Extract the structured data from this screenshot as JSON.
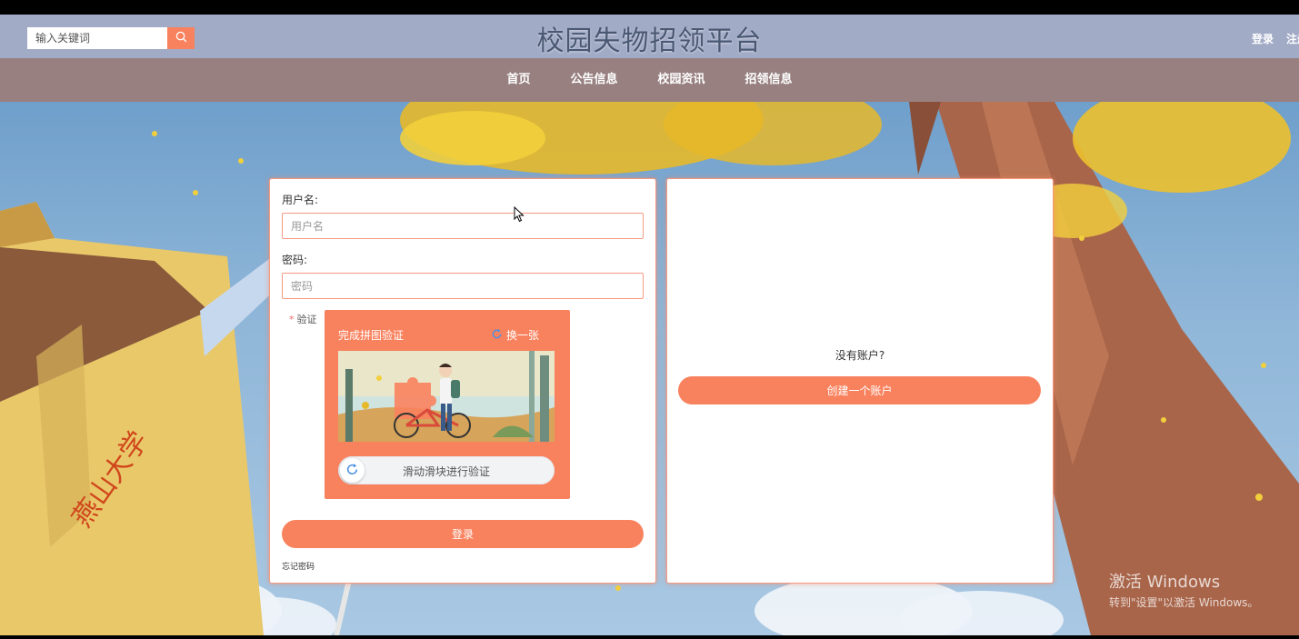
{
  "header": {
    "search_placeholder": "输入关键词",
    "site_title": "校园失物招领平台",
    "login_link": "登录",
    "register_link": "注册"
  },
  "nav": {
    "items": [
      {
        "label": "首页"
      },
      {
        "label": "公告信息"
      },
      {
        "label": "校园资讯"
      },
      {
        "label": "招领信息"
      }
    ]
  },
  "login_form": {
    "username_label": "用户名:",
    "username_placeholder": "用户名",
    "password_label": "密码:",
    "password_placeholder": "密码",
    "verify_required_mark": "*",
    "verify_label": "验证",
    "captcha_title": "完成拼图验证",
    "captcha_refresh": "换一张",
    "slider_text": "滑动滑块进行验证",
    "login_button": "登录",
    "forgot_password": "忘记密码"
  },
  "register_panel": {
    "no_account_text": "没有账户?",
    "create_button": "创建一个账户"
  },
  "watermark": {
    "line1": "激活 Windows",
    "line2": "转到\"设置\"以激活 Windows。"
  },
  "colors": {
    "accent": "#f9825e",
    "header_bg": "#a2abc6",
    "nav_bg": "#988080",
    "title_color": "#4a5873"
  },
  "icons": {
    "search": "search-icon",
    "refresh": "refresh-icon",
    "slider": "refresh-icon"
  }
}
